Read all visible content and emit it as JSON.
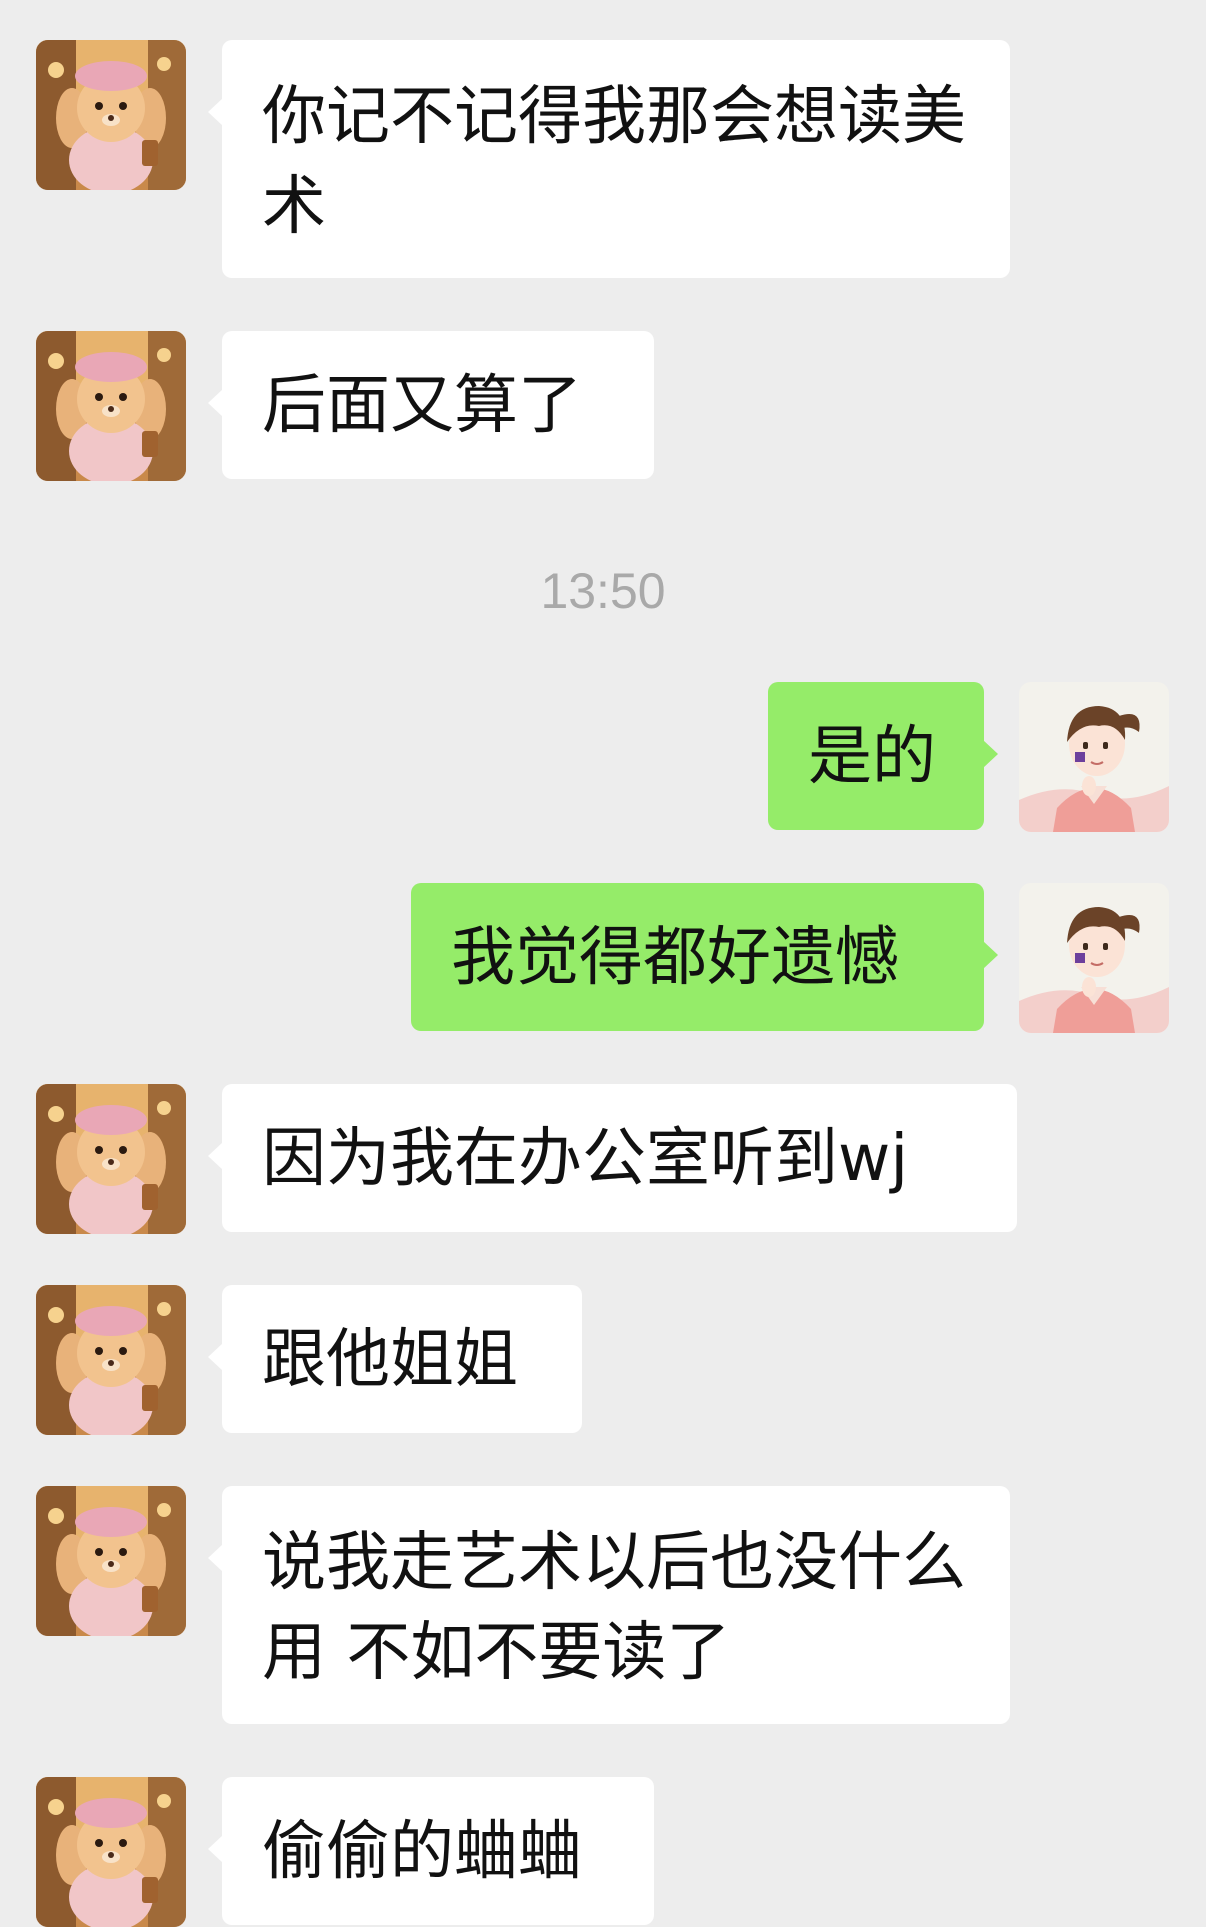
{
  "colors": {
    "background": "#ededed",
    "incoming_bubble": "#ffffff",
    "outgoing_bubble": "#95ec69",
    "timestamp_text": "#a9a9a9"
  },
  "contact": {
    "avatar_icon": "plush-bear-avatar-icon"
  },
  "me": {
    "avatar_icon": "anime-girl-avatar-icon"
  },
  "chat": {
    "messages": [
      {
        "side": "incoming",
        "text": "你记不记得我那会想读美术"
      },
      {
        "side": "incoming",
        "text": "后面又算了"
      },
      {
        "type": "timestamp",
        "text": "13:50"
      },
      {
        "side": "outgoing",
        "text": "是的"
      },
      {
        "side": "outgoing",
        "text": "我觉得都好遗憾"
      },
      {
        "side": "incoming",
        "text": "因为我在办公室听到wj"
      },
      {
        "side": "incoming",
        "text": "跟他姐姐"
      },
      {
        "side": "incoming",
        "text": "说我走艺术以后也没什么用 不如不要读了"
      },
      {
        "side": "incoming",
        "text": "偷偷的蛐蛐"
      }
    ]
  }
}
